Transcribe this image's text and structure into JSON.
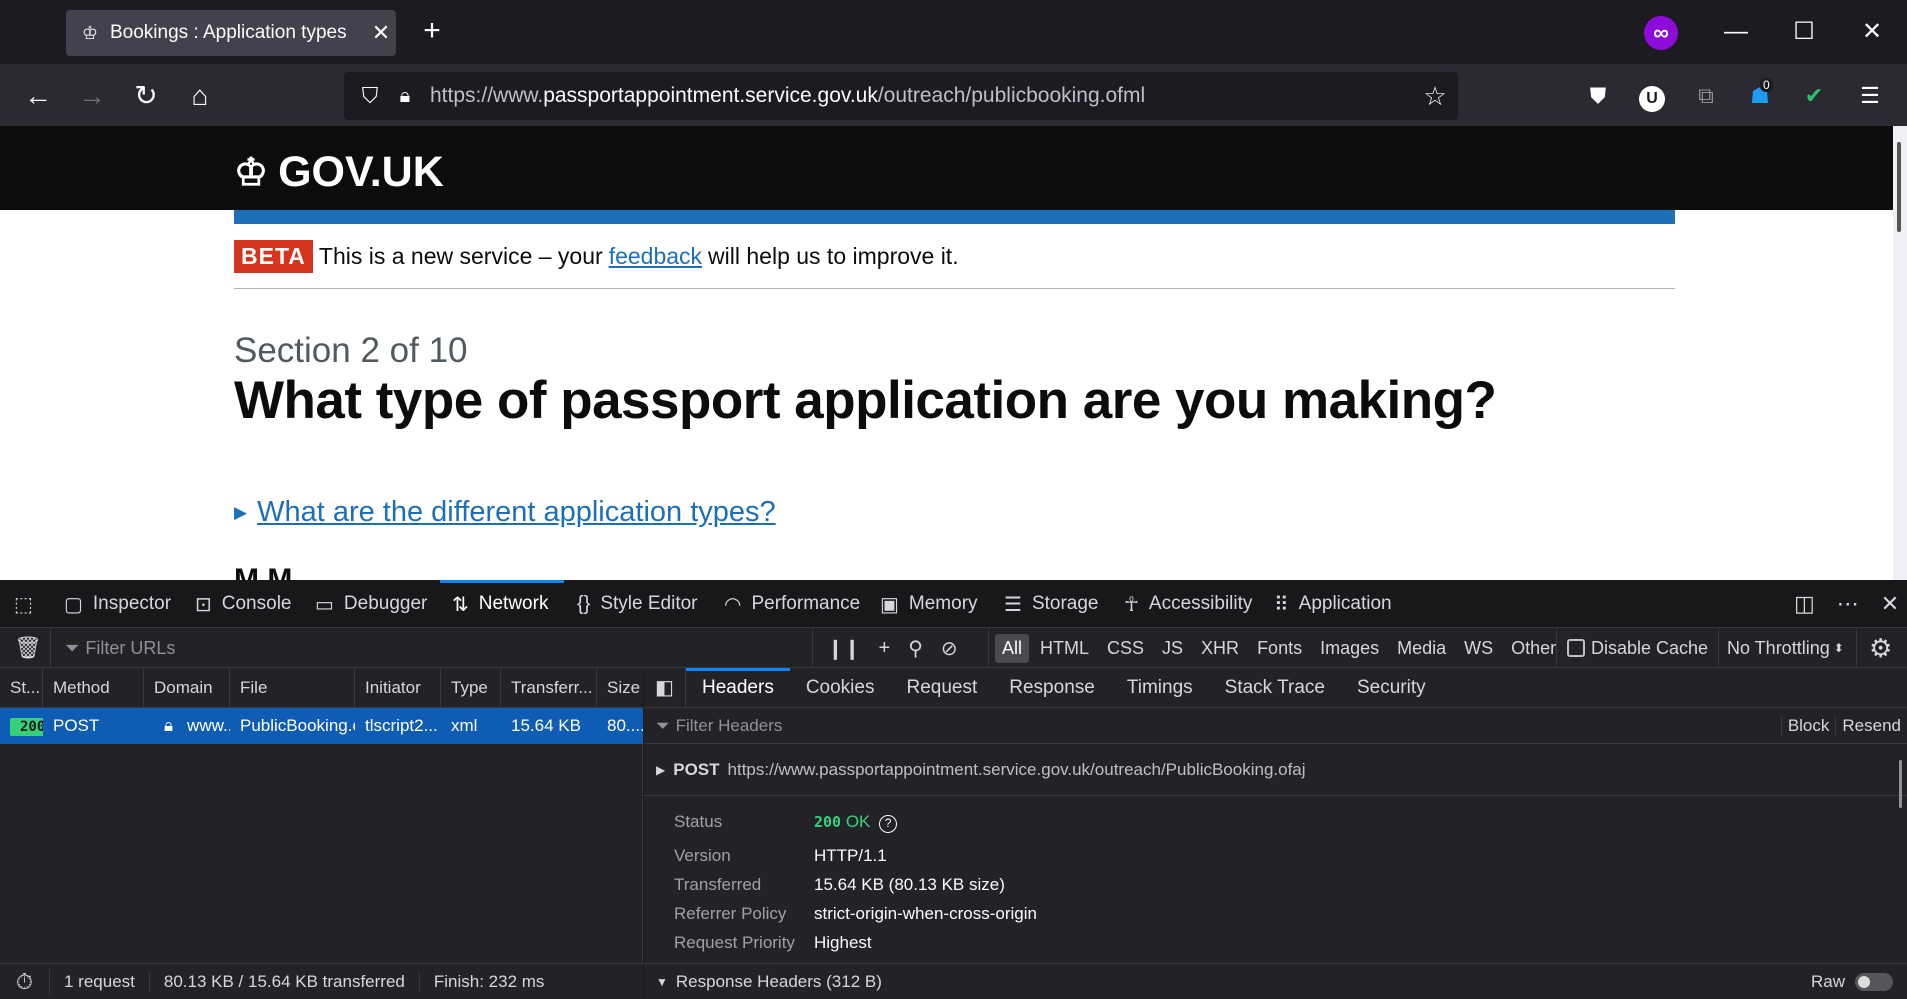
{
  "browser": {
    "tab_title": "Bookings : Application types",
    "tab_close": "✕",
    "new_tab": "+",
    "url_prefix": "https://www.",
    "url_host": "passportappointment.service.gov.uk",
    "url_path": "/outreach/publicbooking.ofml",
    "ext_badge": "0",
    "private_icon": "∞",
    "profile_letter": "U"
  },
  "page": {
    "logo_text": "GOV.UK",
    "beta_tag": "BETA",
    "beta_before": "This is a new service – your",
    "beta_link": "feedback",
    "beta_after": "will help us to improve it.",
    "section": "Section 2 of 10",
    "heading": "What type of passport application are you making?",
    "details_link": "What are the different application types?",
    "cutoff_text": "M M"
  },
  "devtools": {
    "tabs": [
      {
        "label": "Inspector",
        "icon": "inspector-icon"
      },
      {
        "label": "Console",
        "icon": "console-icon"
      },
      {
        "label": "Debugger",
        "icon": "debugger-icon"
      },
      {
        "label": "Network",
        "icon": "network-icon"
      },
      {
        "label": "Style Editor",
        "icon": "style-editor-icon"
      },
      {
        "label": "Performance",
        "icon": "performance-icon"
      },
      {
        "label": "Memory",
        "icon": "memory-icon"
      },
      {
        "label": "Storage",
        "icon": "storage-icon"
      },
      {
        "label": "Accessibility",
        "icon": "accessibility-icon"
      },
      {
        "label": "Application",
        "icon": "application-icon"
      }
    ],
    "filter_placeholder": "Filter URLs",
    "filters": [
      "All",
      "HTML",
      "CSS",
      "JS",
      "XHR",
      "Fonts",
      "Images",
      "Media",
      "WS",
      "Other"
    ],
    "disable_cache": "Disable Cache",
    "throttling": "No Throttling",
    "columns": [
      "St...",
      "Method",
      "Domain",
      "File",
      "Initiator",
      "Type",
      "Transferr...",
      "Size"
    ],
    "request": {
      "status": "200",
      "method": "POST",
      "domain": "www....",
      "file": "PublicBooking.c",
      "initiator": "tlscript2...",
      "type": "xml",
      "transferred": "15.64 KB",
      "size": "80...."
    },
    "footer": {
      "requests": "1 request",
      "transferred": "80.13 KB / 15.64 KB transferred",
      "finish": "Finish: 232 ms"
    },
    "detail_tabs": [
      "Headers",
      "Cookies",
      "Request",
      "Response",
      "Timings",
      "Stack Trace",
      "Security"
    ],
    "filter_headers_placeholder": "Filter Headers",
    "block_label": "Block",
    "resend_label": "Resend",
    "post_method": "POST",
    "post_url": "https://www.passportappointment.service.gov.uk/outreach/PublicBooking.ofaj",
    "summary": [
      {
        "key": "Status",
        "value": "200 OK"
      },
      {
        "key": "Version",
        "value": "HTTP/1.1"
      },
      {
        "key": "Transferred",
        "value": "15.64 KB (80.13 KB size)"
      },
      {
        "key": "Referrer Policy",
        "value": "strict-origin-when-cross-origin"
      },
      {
        "key": "Request Priority",
        "value": "Highest"
      }
    ],
    "status_code": "200",
    "status_text": "OK",
    "response_headers": "Response Headers (312 B)",
    "raw_label": "Raw"
  }
}
